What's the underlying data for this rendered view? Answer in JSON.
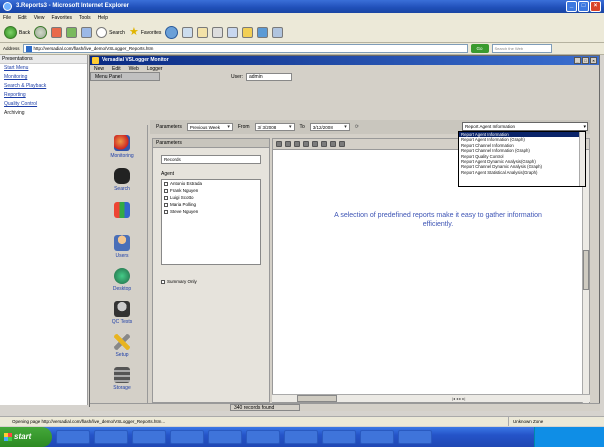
{
  "browser": {
    "title": "3.Reports3 - Microsoft Internet Explorer",
    "menu": [
      "File",
      "Edit",
      "View",
      "Favorites",
      "Tools",
      "Help"
    ],
    "back_label": "Back",
    "search_label": "Search",
    "favorites_label": "Favorites",
    "address_label": "Address",
    "address_value": "http://versadial.com/flash/live_demo/VSLogger_Reports.htm",
    "go_label": "Go",
    "search_placeholder": "Search the Web",
    "status_text": "Opening page http://versadial.com/flash/live_demo/VSLogger_Reports.htm...",
    "zone_text": "Unknown Zone"
  },
  "left_pane": {
    "header": "Presentations",
    "links": [
      "Start Menu",
      "Monitoring",
      "Search & Playback",
      "Reporting",
      "Quality Control"
    ],
    "extra": "Archiving"
  },
  "app": {
    "title": "Versadial VSLogger Monitor",
    "menu": [
      "New",
      "Edit",
      "Web",
      "Logger"
    ],
    "menu_panel": "Menu Panel",
    "user_label": "User:",
    "user_value": "admin",
    "icons": [
      "Monitoring",
      "Search",
      "",
      "Users",
      "Desktop",
      "QC Tests",
      "Setup",
      "Storage"
    ],
    "param_label": "Parameters",
    "period_label": "Previous Week",
    "from_label": "From",
    "from_value": "3/ 3/2008",
    "to_label": "To",
    "to_value": "3/12/2008",
    "report_selected": "Report Agent Information",
    "report_options": [
      "Report Agent Information",
      "Report Agent Information (Graph)",
      "Report Channel Information",
      "Report Channel Information (Graph)",
      "Report Quality Control",
      "Report Agent Dynamic Analysis(Graph)",
      "Report Channel Dynamic Analysis (Graph)",
      "Report Agent Statistical Analysis(Graph)"
    ],
    "panel_header": "Parameters",
    "records_select": "Records",
    "agent_label": "Agent",
    "agents": [
      "Antonio Estrada",
      "Frank Nguyen",
      "Luigi Scotto",
      "Maria Polling",
      "Steve Nguyen"
    ],
    "summary_label": "Summary Only",
    "viewer_message": "A selection of predefined reports make it easy to gather information efficiently.",
    "records_found": "340 records found"
  },
  "taskbar": {
    "start_label": "start"
  }
}
